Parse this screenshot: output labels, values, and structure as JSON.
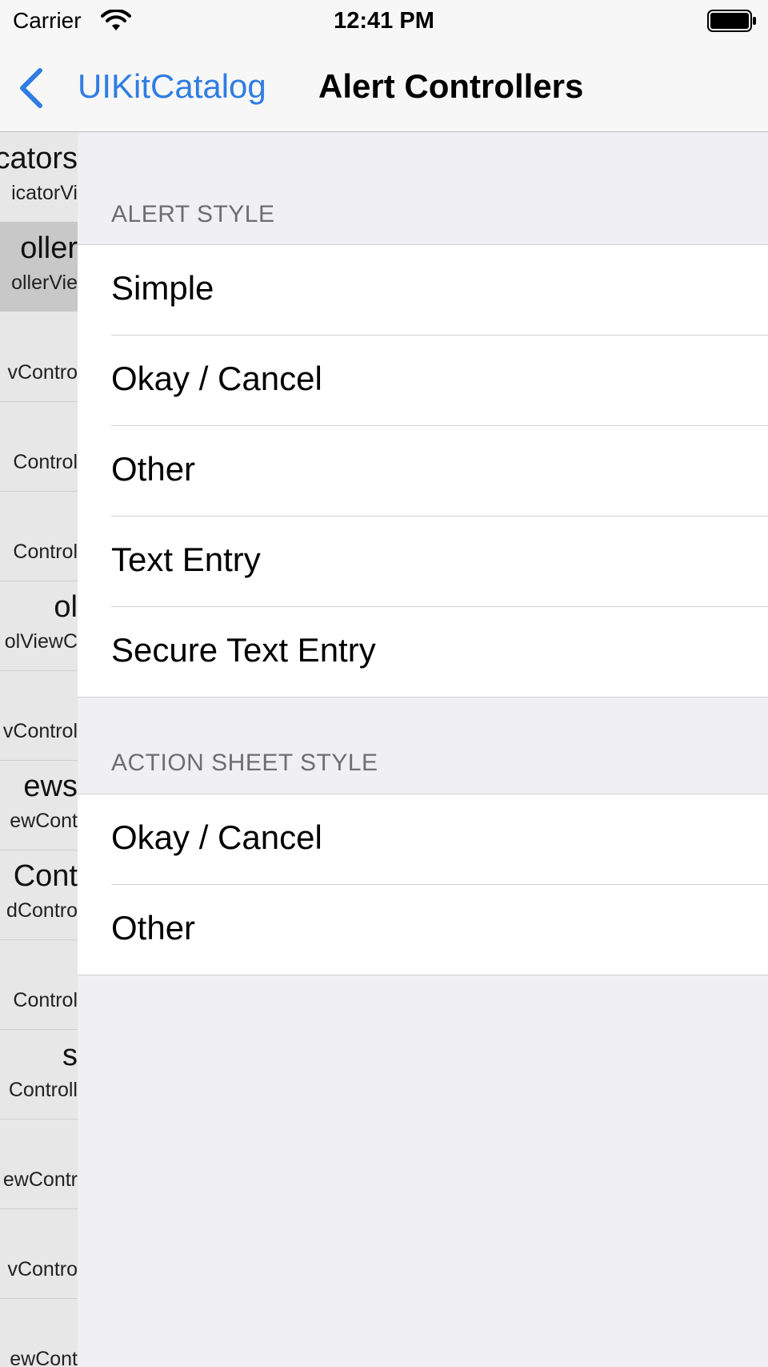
{
  "status_bar": {
    "carrier": "Carrier",
    "time": "12:41 PM",
    "wifi_icon": "wifi-icon",
    "battery_icon": "battery-icon"
  },
  "nav": {
    "back_label": "UIKitCatalog",
    "title": "Alert Controllers",
    "back_icon": "chevron-left-icon",
    "accent_color": "#2f7de1"
  },
  "master_list": [
    {
      "title": "cators",
      "subtitle": "icatorVi",
      "selected": false
    },
    {
      "title": "oller",
      "subtitle": "ollerVie",
      "selected": true
    },
    {
      "title": "",
      "subtitle": "vContro",
      "selected": false
    },
    {
      "title": "",
      "subtitle": "Control",
      "selected": false
    },
    {
      "title": "",
      "subtitle": "Control",
      "selected": false
    },
    {
      "title": "ol",
      "subtitle": "olViewC",
      "selected": false
    },
    {
      "title": "",
      "subtitle": "vControl",
      "selected": false
    },
    {
      "title": "ews",
      "subtitle": "ewCont",
      "selected": false
    },
    {
      "title": "Cont",
      "subtitle": "dContro",
      "selected": false
    },
    {
      "title": "",
      "subtitle": "Control",
      "selected": false
    },
    {
      "title": "s",
      "subtitle": "Controll",
      "selected": false
    },
    {
      "title": "",
      "subtitle": "ewContr",
      "selected": false
    },
    {
      "title": "",
      "subtitle": "vContro",
      "selected": false
    },
    {
      "title": "",
      "subtitle": "ewCont",
      "selected": false
    }
  ],
  "sections": [
    {
      "header": "ALERT STYLE",
      "items": [
        "Simple",
        "Okay / Cancel",
        "Other",
        "Text Entry",
        "Secure Text Entry"
      ]
    },
    {
      "header": "ACTION SHEET STYLE",
      "items": [
        "Okay / Cancel",
        "Other"
      ]
    }
  ]
}
